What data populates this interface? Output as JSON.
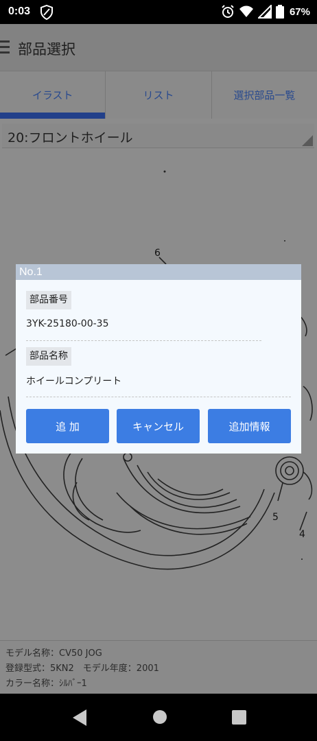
{
  "status": {
    "time": "0:03",
    "battery_percent": "67%"
  },
  "header": {
    "title": "部品選択"
  },
  "tabs": [
    {
      "label": "イラスト",
      "active": true
    },
    {
      "label": "リスト",
      "active": false
    },
    {
      "label": "選択部品一覧",
      "active": false
    }
  ],
  "selector": {
    "value": "20:フロントホイール"
  },
  "illustration": {
    "callouts": [
      "6",
      "5",
      "4"
    ]
  },
  "dialog": {
    "title": "No.1",
    "part_number_label": "部品番号",
    "part_number_value": "3YK-25180-00-35",
    "part_name_label": "部品名称",
    "part_name_value": "ホイールコンプリート",
    "buttons": {
      "add": "追 加",
      "cancel": "キャンセル",
      "more_info": "追加情報"
    }
  },
  "model_info": {
    "line1": "モデル名称：CV50 JOG",
    "line2": "登録型式：5KN2　モデル年度：2001",
    "line3": "カラー名称：ｼﾙﾊﾞｰ1"
  },
  "colors": {
    "accent": "#3c7de3",
    "tab_indicator": "#22408a",
    "tab_text": "#294a8e",
    "dialog_header": "#b8c5d6",
    "scrim": "#8c8c8c"
  }
}
